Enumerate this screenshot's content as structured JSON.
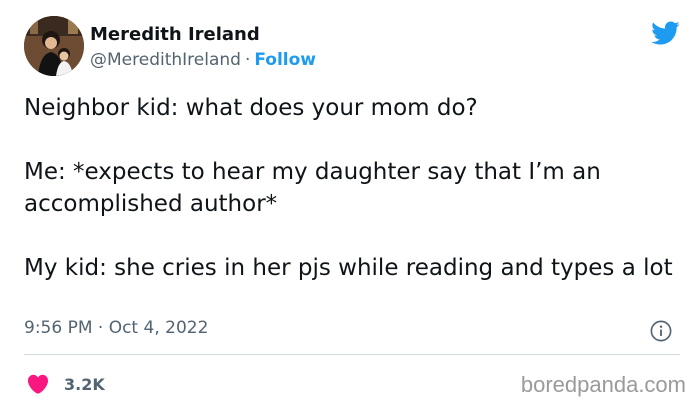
{
  "tweet": {
    "author_name": "Meredith Ireland",
    "handle": "@MeredithIreland",
    "separator": "·",
    "follow_label": "Follow",
    "text": "Neighbor kid: what does your mom do?\n\nMe: *expects to hear my daughter say that I’m an accomplished author*\n\nMy kid: she cries in her pjs while reading and types a lot",
    "timestamp": "9:56 PM · Oct 4, 2022",
    "like_count": "3.2K"
  },
  "icons": {
    "brand": "twitter-bird-icon",
    "info": "info-icon",
    "like": "heart-icon"
  },
  "colors": {
    "accent": "#1d9bf0",
    "like": "#f91880",
    "secondary_text": "#536471"
  },
  "watermark": {
    "text": "boredpanda.com"
  }
}
